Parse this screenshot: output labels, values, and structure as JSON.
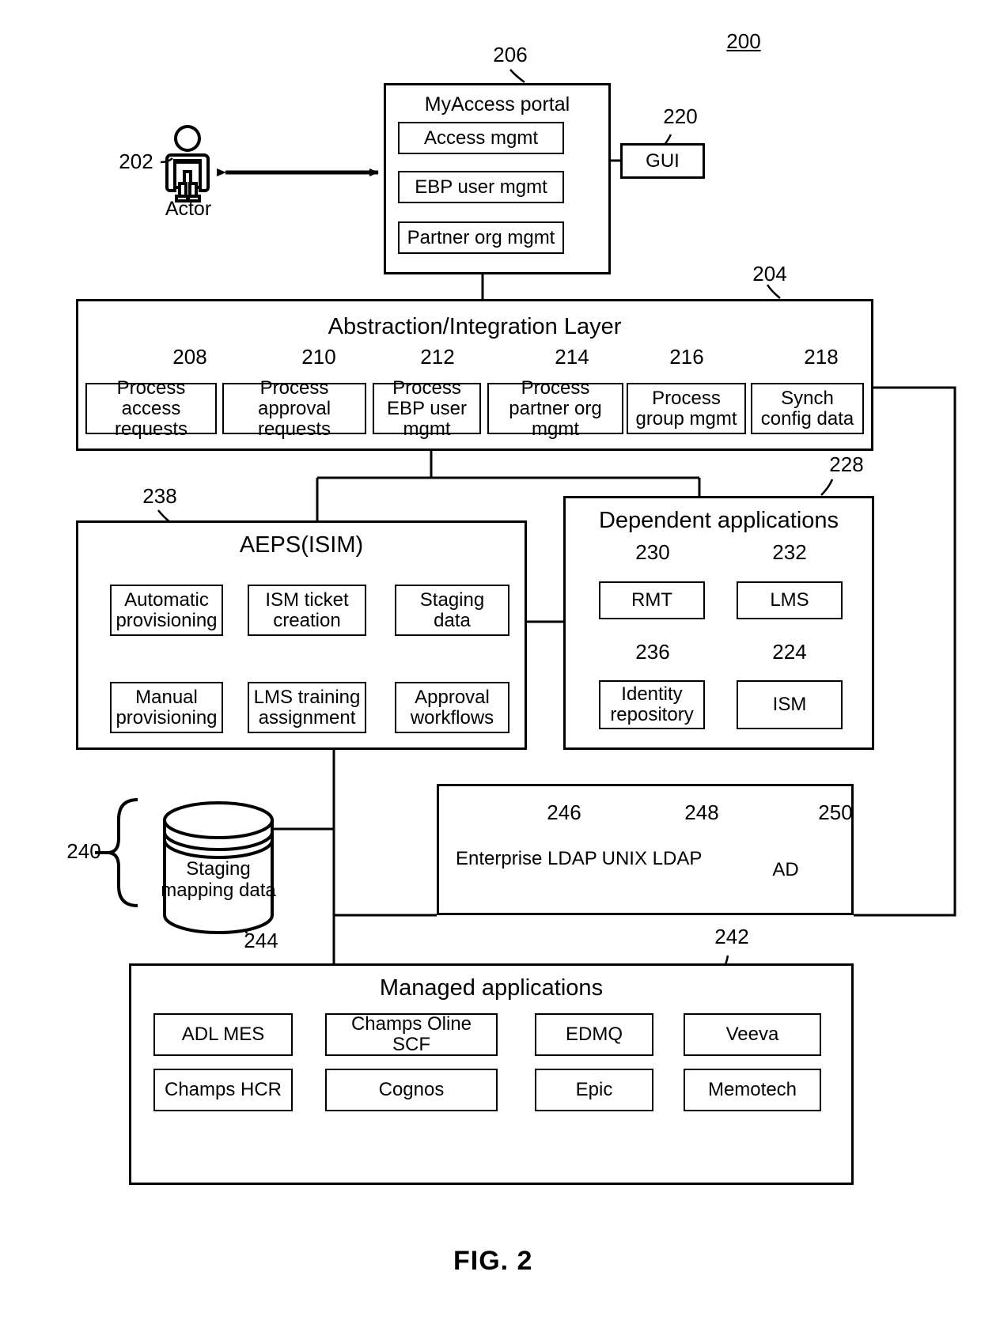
{
  "figure": {
    "caption": "FIG. 2",
    "system_ref": "200"
  },
  "actor": {
    "ref": "202",
    "label": "Actor",
    "icon": "person-icon"
  },
  "portal": {
    "ref": "206",
    "title": "MyAccess portal",
    "items": [
      {
        "label": "Access mgmt"
      },
      {
        "label": "EBP user mgmt"
      },
      {
        "label": "Partner org mgmt"
      }
    ]
  },
  "gui": {
    "ref": "220",
    "label": "GUI"
  },
  "abstraction_layer": {
    "ref": "204",
    "title": "Abstraction/Integration Layer",
    "items": [
      {
        "ref": "208",
        "label": "Process access requests"
      },
      {
        "ref": "210",
        "label": "Process approval requests"
      },
      {
        "ref": "212",
        "label": "Process EBP user mgmt"
      },
      {
        "ref": "214",
        "label": "Process partner org mgmt"
      },
      {
        "ref": "216",
        "label": "Process group mgmt"
      },
      {
        "ref": "218",
        "label": "Synch config data"
      }
    ]
  },
  "aeps": {
    "ref": "238",
    "title": "AEPS(ISIM)",
    "items": [
      {
        "label": "Automatic provisioning"
      },
      {
        "label": "ISM ticket creation"
      },
      {
        "label": "Staging data"
      },
      {
        "label": "Manual provisioning"
      },
      {
        "label": "LMS training assignment"
      },
      {
        "label": "Approval workflows"
      }
    ]
  },
  "dependent_applications": {
    "ref": "228",
    "title": "Dependent applications",
    "items": [
      {
        "ref": "230",
        "label": "RMT"
      },
      {
        "ref": "232",
        "label": "LMS"
      },
      {
        "ref": "236",
        "label": "Identity repository"
      },
      {
        "ref": "224",
        "label": "ISM"
      }
    ]
  },
  "staging_store": {
    "bracket_ref": "240",
    "ref": "244",
    "label": "Staging mapping data",
    "shape": "cylinder"
  },
  "directories": {
    "items": [
      {
        "ref": "246",
        "label": "Enterprise LDAP",
        "shape": "triangle"
      },
      {
        "ref": "248",
        "label": "UNIX LDAP",
        "shape": "triangle"
      },
      {
        "ref": "250",
        "label": "AD",
        "shape": "triangle"
      }
    ]
  },
  "managed_applications": {
    "ref": "242",
    "title": "Managed applications",
    "items": [
      {
        "label": "ADL MES"
      },
      {
        "label": "Champs Oline SCF"
      },
      {
        "label": "EDMQ"
      },
      {
        "label": "Veeva"
      },
      {
        "label": "Champs HCR"
      },
      {
        "label": "Cognos"
      },
      {
        "label": "Epic"
      },
      {
        "label": "Memotech"
      }
    ]
  }
}
